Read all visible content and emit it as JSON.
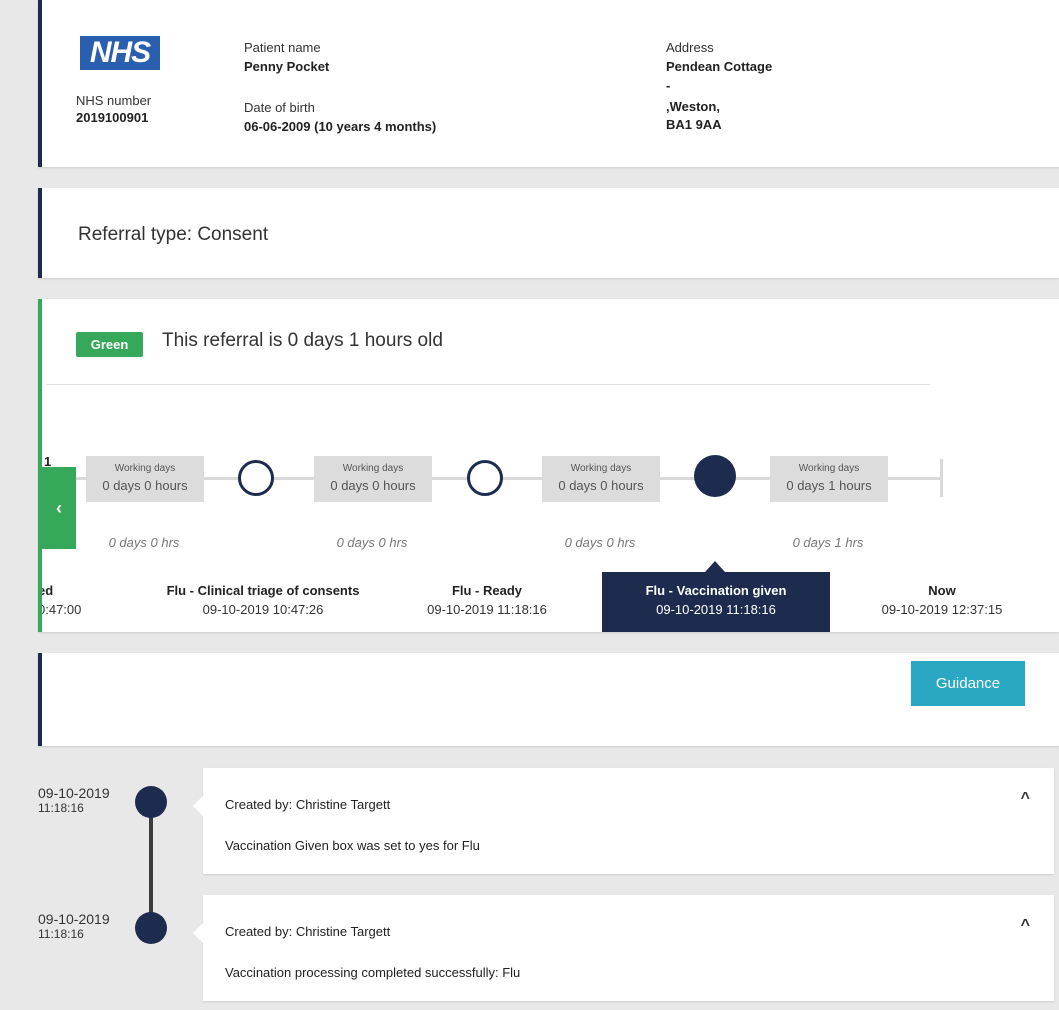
{
  "patient": {
    "logo_text": "NHS",
    "nhs_number_label": "NHS number",
    "nhs_number": "2019100901",
    "name_label": "Patient name",
    "name": "Penny Pocket",
    "dob_label": "Date of birth",
    "dob": "06-06-2009 (10 years 4 months)",
    "address_label": "Address",
    "address_line1": "Pendean Cottage",
    "address_line2": "-",
    "address_line3": ",Weston,",
    "postcode": "BA1 9AA"
  },
  "referral": {
    "type_text": "Referral type: Consent"
  },
  "age": {
    "badge": "Green",
    "text": "This referral is 0 days 1 hours old",
    "badge_color": "#35a85a"
  },
  "timeline": {
    "left_tab_icon": "chevron-left-icon",
    "left_tab_glyph": "‹",
    "cut_off_label": "1",
    "working_days": [
      {
        "label": "Working days",
        "value": "0 days 0 hours"
      },
      {
        "label": "Working days",
        "value": "0 days 0 hours"
      },
      {
        "label": "Working days",
        "value": "0 days 0 hours"
      },
      {
        "label": "Working days",
        "value": "0 days 1 hours"
      }
    ],
    "hours": [
      "0 days 0 hrs",
      "0 days 0 hrs",
      "0 days 0 hrs",
      "0 days 1 hrs"
    ],
    "stages": [
      {
        "name": "ed",
        "date": "0:47:00"
      },
      {
        "name": "Flu - Clinical triage of consents",
        "date": "09-10-2019 10:47:26"
      },
      {
        "name": "Flu - Ready",
        "date": "09-10-2019 11:18:16"
      },
      {
        "name": "Flu - Vaccination given",
        "date": "09-10-2019 11:18:16"
      },
      {
        "name": "Now",
        "date": "09-10-2019 12:37:15"
      }
    ]
  },
  "guidance": {
    "button_label": "Guidance",
    "button_color": "#2aa7c3"
  },
  "log": [
    {
      "date": "09-10-2019",
      "time": "11:18:16",
      "created_by": "Created by: Christine Targett",
      "message": "Vaccination Given box was set to yes for Flu",
      "caret": "^"
    },
    {
      "date": "09-10-2019",
      "time": "11:18:16",
      "created_by": "Created by: Christine Targett",
      "message": "Vaccination processing completed successfully: Flu",
      "caret": "^"
    }
  ],
  "colors": {
    "navy": "#1d2b4f",
    "green": "#35a85a",
    "background": "#e8e8e8"
  }
}
